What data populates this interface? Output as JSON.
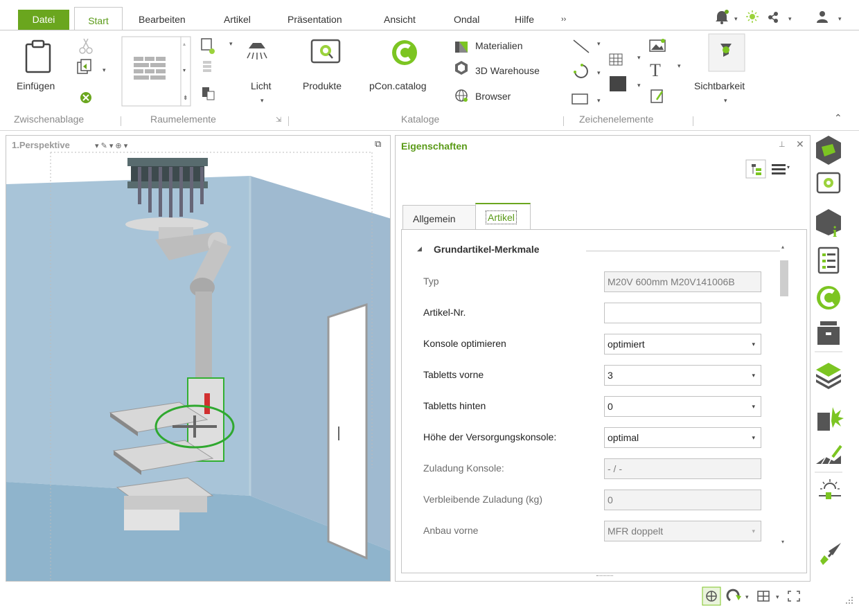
{
  "menu": {
    "datei": "Datei",
    "start": "Start",
    "bearbeiten": "Bearbeiten",
    "artikel": "Artikel",
    "praesentation": "Präsentation",
    "ansicht": "Ansicht",
    "ondal": "Ondal",
    "hilfe": "Hilfe",
    "more": "››"
  },
  "ribbon": {
    "einfuegen": "Einfügen",
    "licht": "Licht",
    "produkte": "Produkte",
    "pcon_catalog": "pCon.catalog",
    "materialien": "Materialien",
    "warehouse": "3D Warehouse",
    "browser": "Browser",
    "sichtbarkeit": "Sichtbarkeit",
    "group_zwischenablage": "Zwischenablage",
    "group_raumelemente": "Raumelemente",
    "group_kataloge": "Kataloge",
    "group_zeichenelemente": "Zeichenelemente",
    "text_tool_glyph": "T"
  },
  "viewport": {
    "title": "1.Perspektive"
  },
  "properties": {
    "title": "Eigenschaften",
    "tabs": [
      "Allgemein",
      "Artikel"
    ],
    "section": "Grundartikel-Merkmale",
    "rows": [
      {
        "label": "Typ",
        "value": "M20V 600mm M20V141006B",
        "dropdown": false,
        "readonly": true
      },
      {
        "label": "Artikel-Nr.",
        "value": "",
        "dropdown": false,
        "readonly": false
      },
      {
        "label": "Konsole optimieren",
        "value": "optimiert",
        "dropdown": true,
        "readonly": false
      },
      {
        "label": "Tabletts vorne",
        "value": "3",
        "dropdown": true,
        "readonly": false
      },
      {
        "label": "Tabletts hinten",
        "value": "0",
        "dropdown": true,
        "readonly": false
      },
      {
        "label": "Höhe der Versorgungskonsole:",
        "value": "optimal",
        "dropdown": true,
        "readonly": false
      },
      {
        "label": "Zuladung Konsole:",
        "value": "- / -",
        "dropdown": false,
        "readonly": true
      },
      {
        "label": "Verbleibende Zuladung (kg)",
        "value": "0",
        "dropdown": false,
        "readonly": true
      },
      {
        "label": "Anbau vorne",
        "value": "MFR doppelt",
        "dropdown": true,
        "readonly": true
      }
    ]
  },
  "right_toolbar": {
    "icons": [
      "pcon-logo-icon",
      "catalog-search-icon",
      "article-info-icon",
      "list-icon",
      "pcon-catalog-icon",
      "archive-icon",
      "layers-icon",
      "room-element-icon",
      "drawing-icon",
      "light-icon",
      "pen-icon"
    ]
  },
  "colors": {
    "accent": "#6aa61e",
    "wall": "#a8c4d8",
    "floor": "#8fb4cc"
  }
}
